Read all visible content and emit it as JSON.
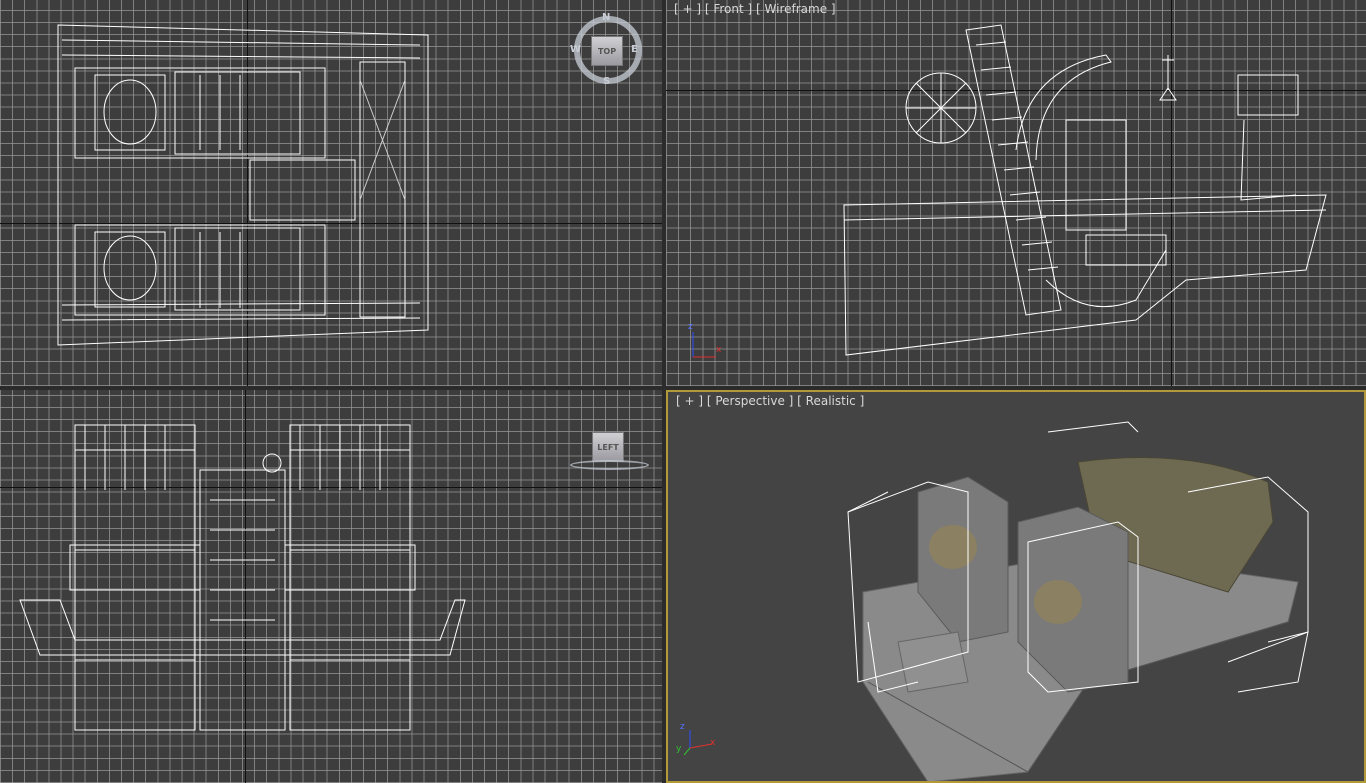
{
  "viewports": {
    "top": {
      "viewcube": {
        "face": "TOP",
        "north": "N",
        "south": "S",
        "east": "E",
        "west": "W"
      }
    },
    "front": {
      "label": "[ + ] [ Front ] [ Wireframe ]"
    },
    "left": {
      "viewcube": {
        "face": "LEFT"
      }
    },
    "perspective": {
      "label": "[ + ] [ Perspective ] [ Realistic ]",
      "active": true
    }
  },
  "axis_labels": {
    "x": "x",
    "y": "y",
    "z": "z"
  },
  "colors": {
    "active_border": "#b29a3a",
    "grid_bg": "#3d3d3d",
    "wire": "#ffffff",
    "x_axis": "#e03030",
    "y_axis": "#30c030",
    "z_axis": "#3050ff"
  }
}
